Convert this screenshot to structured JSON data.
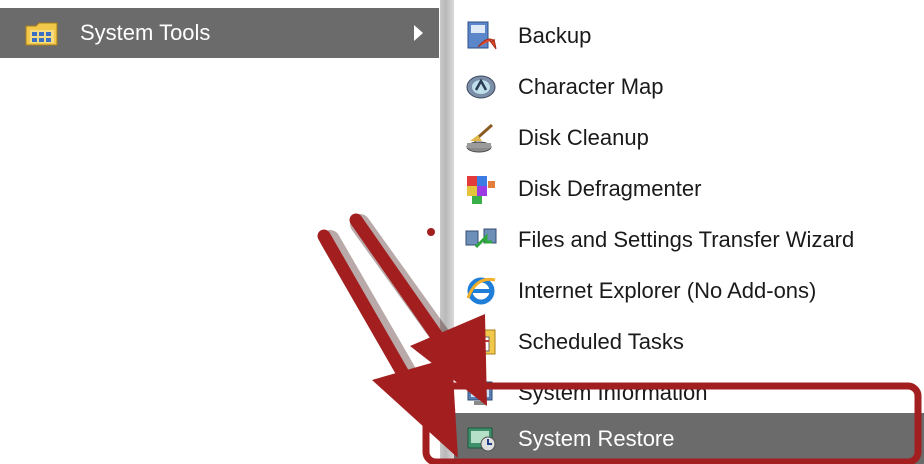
{
  "parent": {
    "label": "System Tools",
    "icon": "programs-folder-icon"
  },
  "submenu": {
    "items": [
      {
        "label": "Backup",
        "icon": "backup-icon"
      },
      {
        "label": "Character Map",
        "icon": "character-map-icon"
      },
      {
        "label": "Disk Cleanup",
        "icon": "disk-cleanup-icon"
      },
      {
        "label": "Disk Defragmenter",
        "icon": "disk-defragmenter-icon"
      },
      {
        "label": "Files and Settings Transfer Wizard",
        "icon": "transfer-wizard-icon"
      },
      {
        "label": "Internet Explorer (No Add-ons)",
        "icon": "internet-explorer-icon"
      },
      {
        "label": "Scheduled Tasks",
        "icon": "scheduled-tasks-icon"
      },
      {
        "label": "System Information",
        "icon": "system-information-icon"
      },
      {
        "label": "System Restore",
        "icon": "system-restore-icon"
      }
    ]
  },
  "colors": {
    "highlight": "#6b6b6b",
    "annotation": "#a31f1f"
  }
}
